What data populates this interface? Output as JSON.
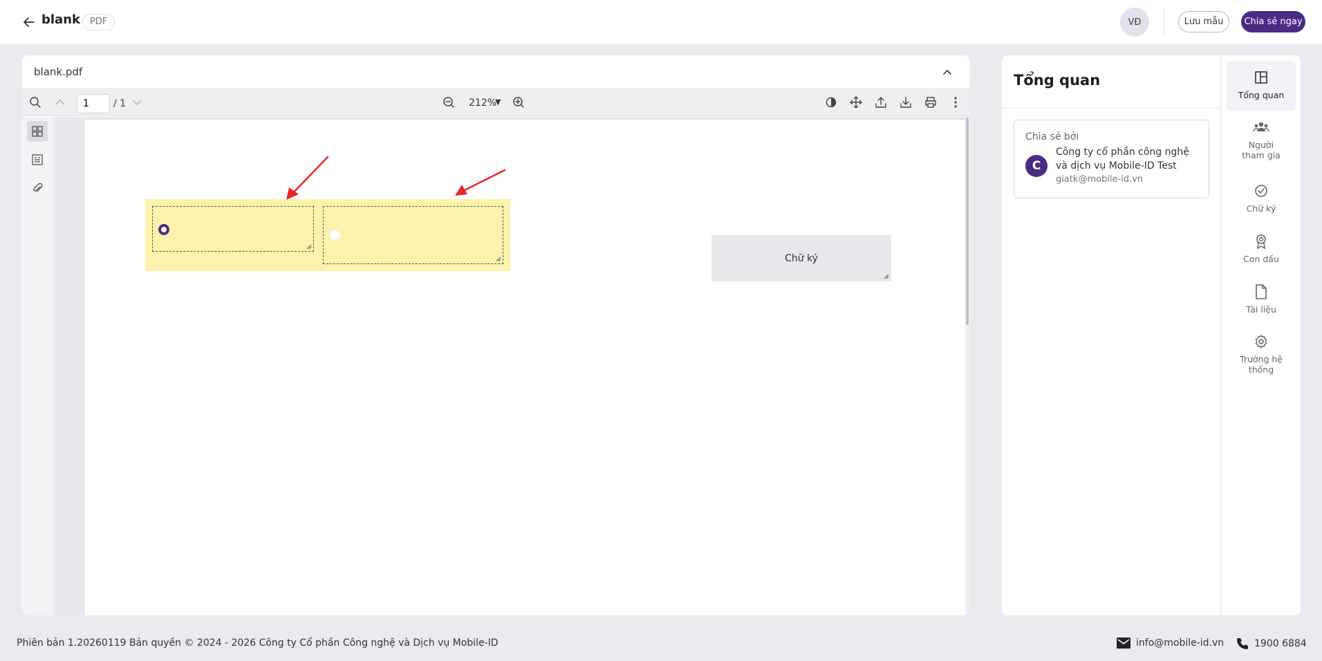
{
  "header": {
    "title": "blank",
    "badge": "PDF",
    "user_initials": "VĐ",
    "save_template_label": "Lưu mẫu",
    "share_now_label": "Chia sẻ ngay"
  },
  "viewer": {
    "file_name": "blank.pdf",
    "page_current": "1",
    "page_total": "/ 1",
    "zoom": "212%",
    "signature_field_label": "Chữ ký"
  },
  "right_panel": {
    "title": "Tổng quan",
    "shared_by_label": "Chia sẻ bởi",
    "sharer_initial": "C",
    "sharer_name": "Công ty cổ phần công nghệ và dịch vụ Mobile-ID Test",
    "sharer_email": "giatk@mobile-id.vn",
    "nav": [
      {
        "label": "Tổng quan",
        "icon": "overview-icon"
      },
      {
        "label": "Người tham gia",
        "icon": "participants-icon"
      },
      {
        "label": "Chữ ký",
        "icon": "signature-check-icon"
      },
      {
        "label": "Con dấu",
        "icon": "seal-icon"
      },
      {
        "label": "Tài liệu",
        "icon": "document-icon"
      },
      {
        "label": "Trường hệ thống",
        "icon": "gear-icon"
      }
    ]
  },
  "footer": {
    "copyright": "Phiên bản 1.20260119 Bản quyền © 2024 - 2026 Công ty Cổ phần Công nghệ và Dịch vụ Mobile-ID",
    "email": "info@mobile-id.vn",
    "phone": "1900 6884"
  },
  "colors": {
    "primary": "#4b2c84",
    "radio_group_bg": "#fdf2ab",
    "signature_field_bg": "#e6e8eb",
    "annotation_arrow": "#e8262b"
  }
}
